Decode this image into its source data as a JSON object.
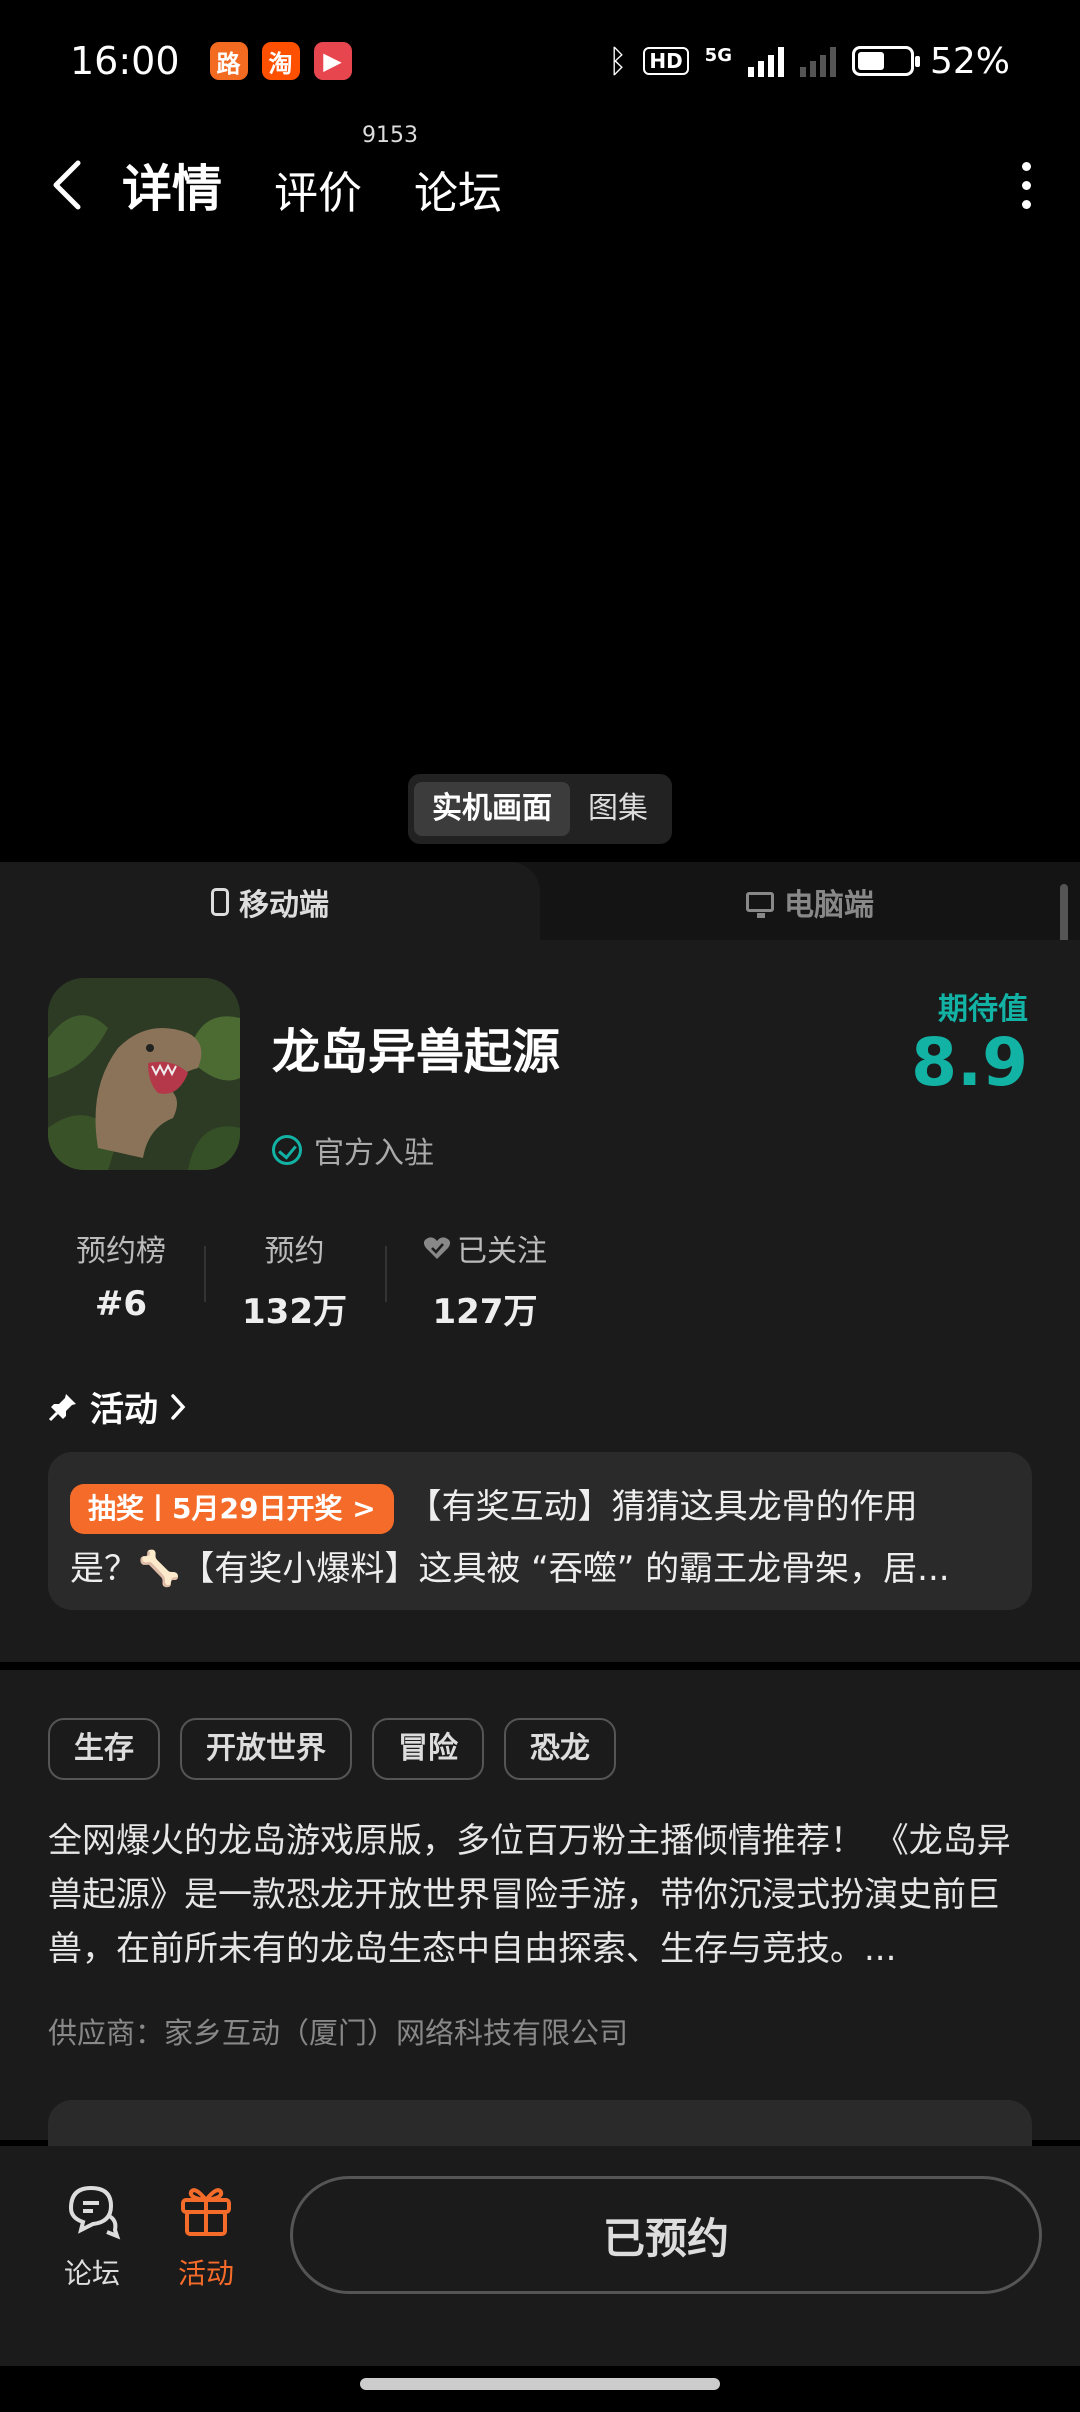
{
  "status": {
    "time": "16:00",
    "battery": "52%",
    "battery_level": 0.52,
    "hd": "HD",
    "net": "5G"
  },
  "app_icons": [
    "路",
    "淘",
    "▶"
  ],
  "nav": {
    "tabs": [
      {
        "label": "详情",
        "active": true
      },
      {
        "label": "评价",
        "badge": "9153"
      },
      {
        "label": "论坛"
      }
    ]
  },
  "media": {
    "segments": [
      "实机画面",
      "图集"
    ]
  },
  "platform": {
    "mobile": "移动端",
    "pc": "电脑端"
  },
  "game": {
    "name": "龙岛异兽起源",
    "official": "官方入驻",
    "expect_label": "期待值",
    "expect_value": "8.9",
    "accent_color": "#12b3a5"
  },
  "stats": [
    {
      "label": "预约榜",
      "value": "#6"
    },
    {
      "label": "预约",
      "value": "132万"
    },
    {
      "label": "已关注",
      "value": "127万"
    }
  ],
  "activity": {
    "heading": "活动",
    "tag": "抽奖丨5月29日开奖 >",
    "line1": "【有奖互动】猜猜这具龙骨的作用",
    "line2": "是？🦴【有奖小爆料】这具被 “吞噬” 的霸王龙骨架，居..."
  },
  "info": {
    "tags": [
      "生存",
      "开放世界",
      "冒险",
      "恐龙"
    ],
    "description": "全网爆火的龙岛游戏原版，多位百万粉主播倾情推荐！ 《龙岛异兽起源》是一款恐龙开放世界冒险手游，带你沉浸式扮演史前巨兽，在前所未有的龙岛生态中自由探索、生存与竞技。...",
    "supplier": "供应商：家乡互动（厦门）网络科技有限公司"
  },
  "bottom": {
    "forum": "论坛",
    "activity": "活动",
    "reserved": "已预约",
    "activity_color": "#f46b2a"
  }
}
